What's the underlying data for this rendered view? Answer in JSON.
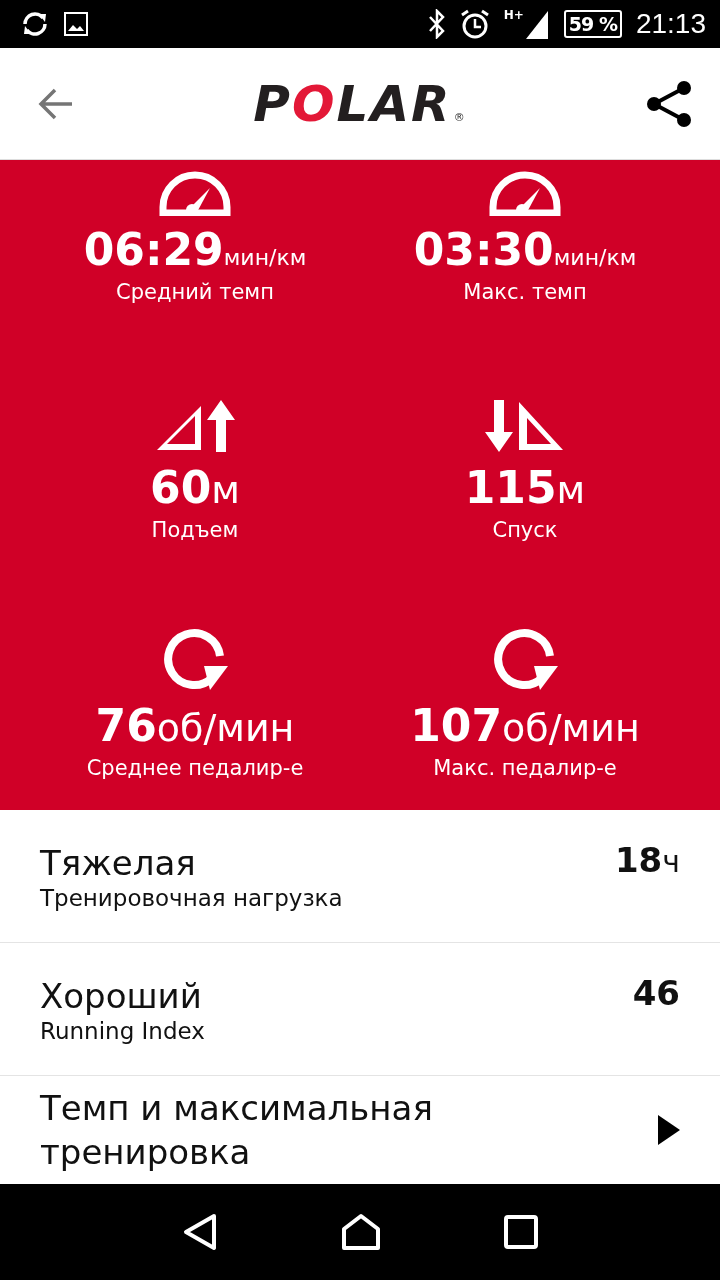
{
  "status_bar": {
    "network": "H+",
    "battery": "59 %",
    "time": "21:13"
  },
  "header": {
    "logo": "POLAR",
    "registered": "®"
  },
  "stats": [
    {
      "kind": "speedometer",
      "value": "06:29",
      "unit": "мин/км",
      "label": "Средний темп"
    },
    {
      "kind": "speedometer",
      "value": "03:30",
      "unit": "мин/км",
      "label": "Макс. темп"
    },
    {
      "kind": "ascent",
      "value": "60",
      "unit": "м",
      "label": "Подъем"
    },
    {
      "kind": "descent",
      "value": "115",
      "unit": "м",
      "label": "Спуск"
    },
    {
      "kind": "cadence",
      "value": "76",
      "unit": "об/мин",
      "label": "Среднее педалир-е"
    },
    {
      "kind": "cadence",
      "value": "107",
      "unit": "об/мин",
      "label": "Макс. педалир-е"
    }
  ],
  "summary": [
    {
      "kind": "value",
      "title": "Тяжелая",
      "subtitle": "Тренировочная нагрузка",
      "value": "18",
      "unit": "ч"
    },
    {
      "kind": "value",
      "title": "Хороший",
      "subtitle": "Running Index",
      "value": "46"
    },
    {
      "kind": "link",
      "title": "Темп и максимальная тренировка"
    }
  ]
}
